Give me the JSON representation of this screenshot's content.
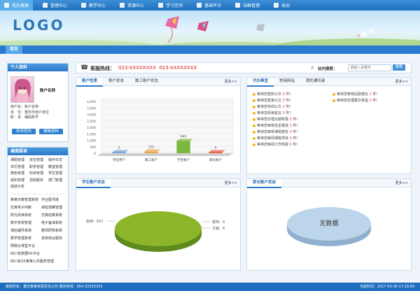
{
  "nav": {
    "items": [
      {
        "label": "我的桌面",
        "icon": "home-icon"
      },
      {
        "label": "管理中心",
        "icon": "grid-icon"
      },
      {
        "label": "教学中心",
        "icon": "people-icon"
      },
      {
        "label": "资源中心",
        "icon": "globe-icon"
      },
      {
        "label": "学习空间",
        "icon": "book-icon"
      },
      {
        "label": "基础平台",
        "icon": "edit-icon"
      },
      {
        "label": "站群管理",
        "icon": "settings-icon"
      },
      {
        "label": "退出",
        "icon": "power-icon"
      }
    ]
  },
  "banner": {
    "logo": "LOGO"
  },
  "tabbar": {
    "home": "首页"
  },
  "hotline": {
    "label": "客服热线：",
    "numbers": "023-XXXXXXXX  023-XXXXXXXX"
  },
  "search": {
    "label": "站内搜索：",
    "placeholder": "请输入关键字",
    "button": "搜索"
  },
  "profile": {
    "title": "个人资料",
    "name": "账户名称",
    "lines": [
      "用户名：账户名称",
      "单　位：重庆市用户单位",
      "职　责：辅助账号"
    ],
    "edit_password": "修改密码",
    "edit_info": "编辑资料"
  },
  "menu": {
    "title": "桌面菜单",
    "rows": [
      [
        "课题管理",
        "单位管理",
        "操作日志"
      ],
      [
        "年历管理",
        "职务管理",
        "教室管理"
      ],
      [
        "角色管理",
        "科目管理",
        "学生管理"
      ],
      [
        "组织管理",
        "自助服务",
        "部门管理"
      ],
      [
        "成绩分析",
        "",
        ""
      ]
    ],
    "systems": [
      [
        "某某示教管理系统",
        "作业图书馆"
      ],
      [
        "仿真电子判断",
        "纳检观察管理"
      ],
      [
        "阳光阅读系统",
        "仿真结算系统"
      ],
      [
        "数字常规管理",
        "电子备课系统"
      ],
      [
        "课后辅导系统",
        "教师研修系统"
      ],
      [
        "数学管理系统",
        "系统综合服务"
      ],
      [
        "网络云课堂平台",
        ""
      ],
      [
        "四川省数据XX平台",
        ""
      ],
      [
        "四川省XX某某公共服务管理",
        ""
      ]
    ]
  },
  "account_panel": {
    "tabs": [
      "账户性质",
      "账户状态",
      "数工账户状态"
    ],
    "more": "更多>>",
    "chart_data": {
      "type": "bar",
      "categories": [
        "单位用户",
        "教工账户",
        "学生账户",
        "家长账户"
      ],
      "values": [
        2,
        132,
        943,
        0
      ],
      "ylim": [
        0,
        4000
      ],
      "yticks": [
        0,
        500,
        1000,
        1500,
        2000,
        2500,
        3000,
        3500,
        4000
      ],
      "colors": [
        "#6fa4dc",
        "#e8a94f",
        "#7cb83d",
        "#e55b3c"
      ]
    }
  },
  "todo_panel": {
    "tabs": [
      "代办事宜",
      "常用网站",
      "我的通讯录"
    ],
    "more": "更多>>",
    "left": [
      {
        "text": "等待您签收公文",
        "num": "0",
        "unit": "件！"
      },
      {
        "text": "等待您签审公文",
        "num": "3",
        "unit": "件！"
      },
      {
        "text": "等待您传阅公文",
        "num": "2",
        "unit": "件！"
      },
      {
        "text": "等待您阅读留言",
        "num": "0",
        "unit": "件！"
      },
      {
        "text": "等待您办理长期举报",
        "num": "0",
        "unit": "件！"
      },
      {
        "text": "等待您审核信息报送",
        "num": "1",
        "unit": "件！"
      },
      {
        "text": "等待您审核课题报告",
        "num": "0",
        "unit": "件！"
      },
      {
        "text": "等待您审阅课题项目",
        "num": "0",
        "unit": "件！"
      },
      {
        "text": "等待您审阅工作简报",
        "num": "0",
        "unit": "件！"
      }
    ],
    "right": [
      {
        "text": "等待您审核后勤报名",
        "num": "2",
        "unit": "件！"
      },
      {
        "text": "等待您处理督办事宜",
        "num": "0",
        "unit": "件！"
      }
    ]
  },
  "student_panel": {
    "title": "学生账户状态",
    "more": "更多>>",
    "chart_data": {
      "type": "pie",
      "labels": [
        "启用",
        "禁用",
        "注销"
      ],
      "values": [
        937,
        0,
        6
      ],
      "colors": [
        "#8db52a",
        "#6ea03a",
        "#9fc54a"
      ]
    },
    "legend": [
      "启用：937",
      "禁用：0",
      "注销：6"
    ]
  },
  "parent_panel": {
    "title": "家长账户状态",
    "more": "更多>>",
    "empty": "无数据"
  },
  "footer": {
    "copyright": "版权所有：重庆某某有限责任公司  服务热线：654-33333333",
    "time": "当前时间：2017-03-30 17:19:59"
  }
}
